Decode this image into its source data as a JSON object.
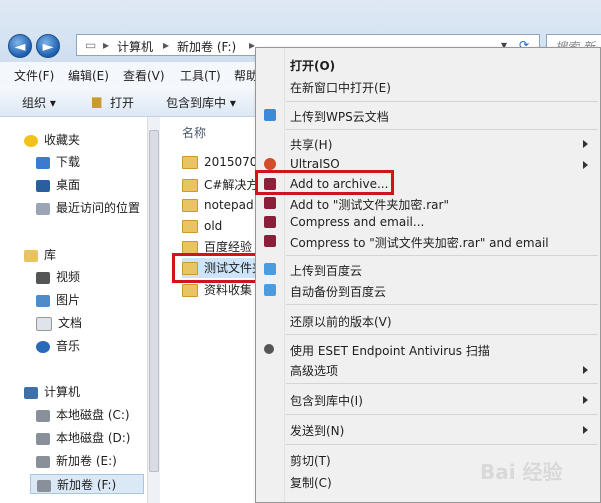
{
  "address": {
    "back": "◄",
    "forward": "►",
    "computer": "计算机",
    "drive": "新加卷 (F:)",
    "search_placeholder": "搜索 新加"
  },
  "menubar": [
    "文件(F)",
    "编辑(E)",
    "查看(V)",
    "工具(T)",
    "帮助"
  ],
  "toolbar": {
    "organize": "组织 ▾",
    "open": "打开",
    "include": "包含到库中 ▾"
  },
  "nav": {
    "favorites": "收藏夹",
    "downloads": "下载",
    "desktop": "桌面",
    "recent": "最近访问的位置",
    "libraries": "库",
    "videos": "视频",
    "pictures": "图片",
    "documents": "文档",
    "music": "音乐",
    "computer": "计算机",
    "driveC": "本地磁盘 (C:)",
    "driveD": "本地磁盘 (D:)",
    "driveE": "新加卷 (E:)",
    "driveF": "新加卷 (F:)"
  },
  "content": {
    "header": "名称",
    "files": [
      "2015070",
      "C#解决方",
      "notepad",
      "old",
      "百度经验",
      "测试文件夹",
      "资料收集"
    ]
  },
  "menu": {
    "open": "打开(O)",
    "open_new": "在新窗口中打开(E)",
    "wps": "上传到WPS云文档",
    "share": "共享(H)",
    "ultraiso": "UltraISO",
    "add_archive": "Add to archive...",
    "add_rar": "Add to \"测试文件夹加密.rar\"",
    "compress_email": "Compress and email...",
    "compress_rar_email": "Compress to \"测试文件夹加密.rar\" and email",
    "baidu_up": "上传到百度云",
    "baidu_backup": "自动备份到百度云",
    "restore": "还原以前的版本(V)",
    "eset": "使用 ESET Endpoint Antivirus 扫描",
    "advanced": "高级选项",
    "include": "包含到库中(I)",
    "send_to": "发送到(N)",
    "cut": "剪切(T)",
    "copy": "复制(C)"
  },
  "watermark": "Bai 经验"
}
